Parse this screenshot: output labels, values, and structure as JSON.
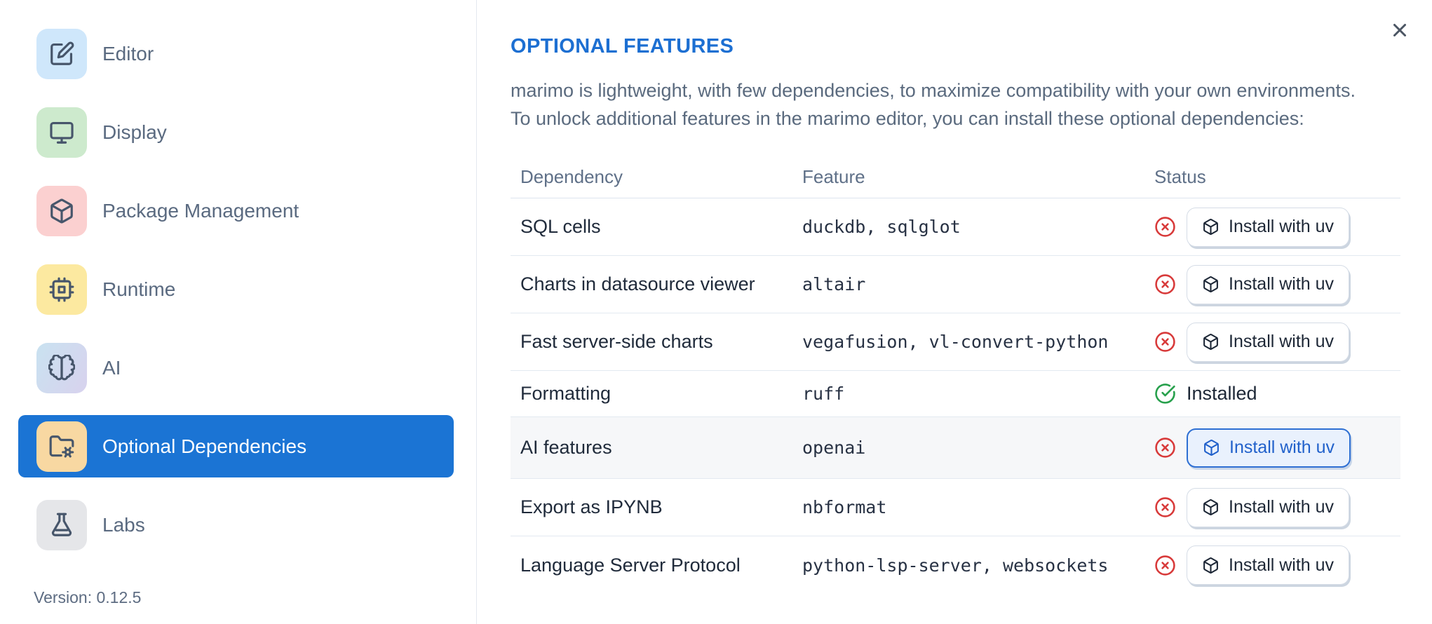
{
  "sidebar": {
    "items": [
      {
        "label": "Editor",
        "icon": "edit-icon",
        "tile_color": "#cfe7fb"
      },
      {
        "label": "Display",
        "icon": "monitor-icon",
        "tile_color": "#cdeacd"
      },
      {
        "label": "Package Management",
        "icon": "package-icon",
        "tile_color": "#fbd0d0"
      },
      {
        "label": "Runtime",
        "icon": "cpu-icon",
        "tile_color": "#fce9a0"
      },
      {
        "label": "AI",
        "icon": "brain-icon",
        "tile_color": "linear-gradient(120deg,#c9e2f0,#d8d2ee)"
      },
      {
        "label": "Optional Dependencies",
        "icon": "folder-cog-icon",
        "tile_color": "#f8d8a2"
      },
      {
        "label": "Labs",
        "icon": "flask-icon",
        "tile_color": "#e5e6e9"
      }
    ],
    "selected_index": 5,
    "version_label": "Version: 0.12.5"
  },
  "panel": {
    "title": "OPTIONAL FEATURES",
    "description_line1": "marimo is lightweight, with few dependencies, to maximize compatibility with your own environments.",
    "description_line2": "To unlock additional features in the marimo editor, you can install these optional dependencies:",
    "table": {
      "headers": [
        "Dependency",
        "Feature",
        "Status"
      ],
      "install_button_label": "Install with uv",
      "rows": [
        {
          "dependency": "SQL cells",
          "feature": "duckdb, sqlglot",
          "status": "missing",
          "action": "Install with uv"
        },
        {
          "dependency": "Charts in datasource viewer",
          "feature": "altair",
          "status": "missing",
          "action": "Install with uv"
        },
        {
          "dependency": "Fast server-side charts",
          "feature": "vegafusion, vl-convert-python",
          "status": "missing",
          "action": "Install with uv"
        },
        {
          "dependency": "Formatting",
          "feature": "ruff",
          "status": "installed",
          "status_label": "Installed"
        },
        {
          "dependency": "AI features",
          "feature": "openai",
          "status": "missing",
          "action": "Install with uv",
          "highlighted": true
        },
        {
          "dependency": "Export as IPYNB",
          "feature": "nbformat",
          "status": "missing",
          "action": "Install with uv"
        },
        {
          "dependency": "Language Server Protocol",
          "feature": "python-lsp-server, websockets",
          "status": "missing",
          "action": "Install with uv"
        }
      ]
    }
  },
  "colors": {
    "accent_blue": "#1b74d4",
    "title_blue": "#1c6fd2",
    "missing_red": "#d83a3a",
    "installed_green": "#27a04c",
    "highlight_button_blue": "#2e6fd3"
  }
}
